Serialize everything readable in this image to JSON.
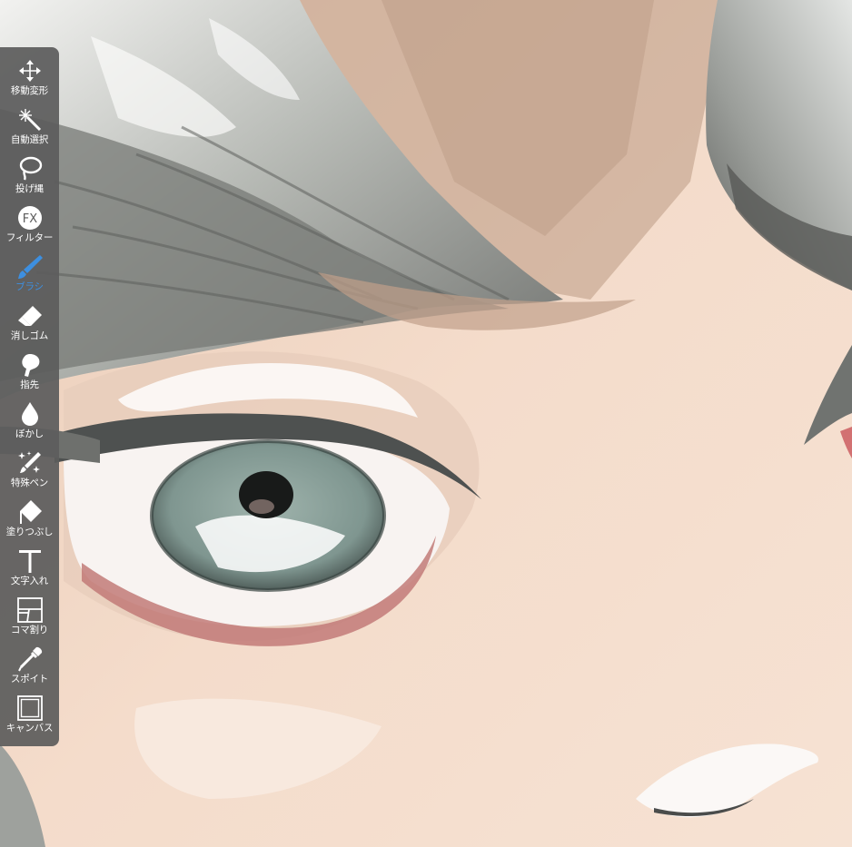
{
  "app": {
    "accent_color": "#3d8fe0",
    "toolbar_bg": "#5c5c5c"
  },
  "toolbar": {
    "active_tool": "brush",
    "tools": [
      {
        "id": "move",
        "label": "移動変形",
        "icon": "move-arrows-icon"
      },
      {
        "id": "magic-wand",
        "label": "自動選択",
        "icon": "magic-wand-icon"
      },
      {
        "id": "lasso",
        "label": "投げ縄",
        "icon": "lasso-icon"
      },
      {
        "id": "filter",
        "label": "フィルター",
        "icon": "fx-icon"
      },
      {
        "id": "brush",
        "label": "ブラシ",
        "icon": "brush-icon"
      },
      {
        "id": "eraser",
        "label": "消しゴム",
        "icon": "eraser-icon"
      },
      {
        "id": "smudge",
        "label": "指先",
        "icon": "smudge-icon"
      },
      {
        "id": "blur",
        "label": "ぼかし",
        "icon": "blur-drop-icon"
      },
      {
        "id": "special-pen",
        "label": "特殊ペン",
        "icon": "special-pen-icon"
      },
      {
        "id": "fill",
        "label": "塗りつぶし",
        "icon": "fill-bucket-icon"
      },
      {
        "id": "text",
        "label": "文字入れ",
        "icon": "text-icon"
      },
      {
        "id": "frame-divider",
        "label": "コマ割り",
        "icon": "frame-divider-icon"
      },
      {
        "id": "eyedropper",
        "label": "スポイト",
        "icon": "eyedropper-icon"
      },
      {
        "id": "canvas",
        "label": "キャンバス",
        "icon": "canvas-icon"
      }
    ]
  }
}
